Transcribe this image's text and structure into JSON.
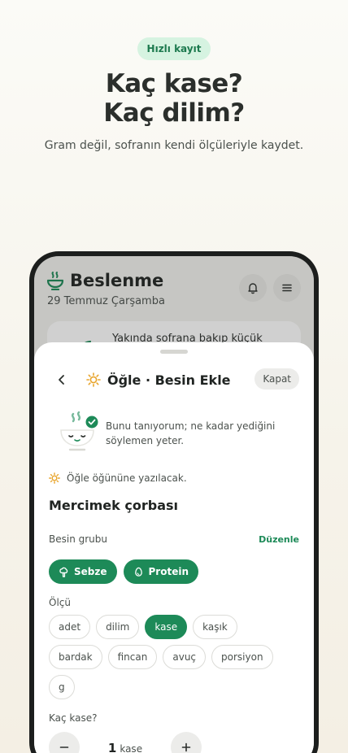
{
  "hero": {
    "badge": "Hızlı kayıt",
    "headline_line1": "Kaç kase?",
    "headline_line2": "Kaç dilim?",
    "tagline": "Gram değil, sofranın kendi ölçüleriyle kaydet."
  },
  "app": {
    "title": "Beslenme",
    "date": "29 Temmuz Çarşamba",
    "background_card_text": "Yakında sofrana bakıp küçük",
    "icons": {
      "brand": "bowl-icon",
      "notifications": "bell-icon",
      "menu": "menu-icon"
    }
  },
  "sheet": {
    "title": "Öğle · Besin Ekle",
    "close_label": "Kapat",
    "intro_text": "Bunu tanıyorum; ne kadar yediğini söylemen yeter.",
    "meal_note": "Öğle öğününe yazılacak.",
    "food_name": "Mercimek çorbası",
    "group_label": "Besin grubu",
    "edit_label": "Düzenle",
    "groups": [
      {
        "label": "Sebze",
        "icon": "broccoli-icon"
      },
      {
        "label": "Protein",
        "icon": "egg-icon"
      }
    ],
    "unit_label": "Ölçü",
    "units": [
      "adet",
      "dilim",
      "kase",
      "kaşık",
      "bardak",
      "fincan",
      "avuç",
      "porsiyon",
      "g"
    ],
    "selected_unit": "kase",
    "quantity_label": "Kaç kase?",
    "quantity": "1",
    "quantity_unit": "kase"
  },
  "colors": {
    "accent": "#1d8a58",
    "badge_bg": "#d6f3e1",
    "text": "#2b2f2c"
  }
}
